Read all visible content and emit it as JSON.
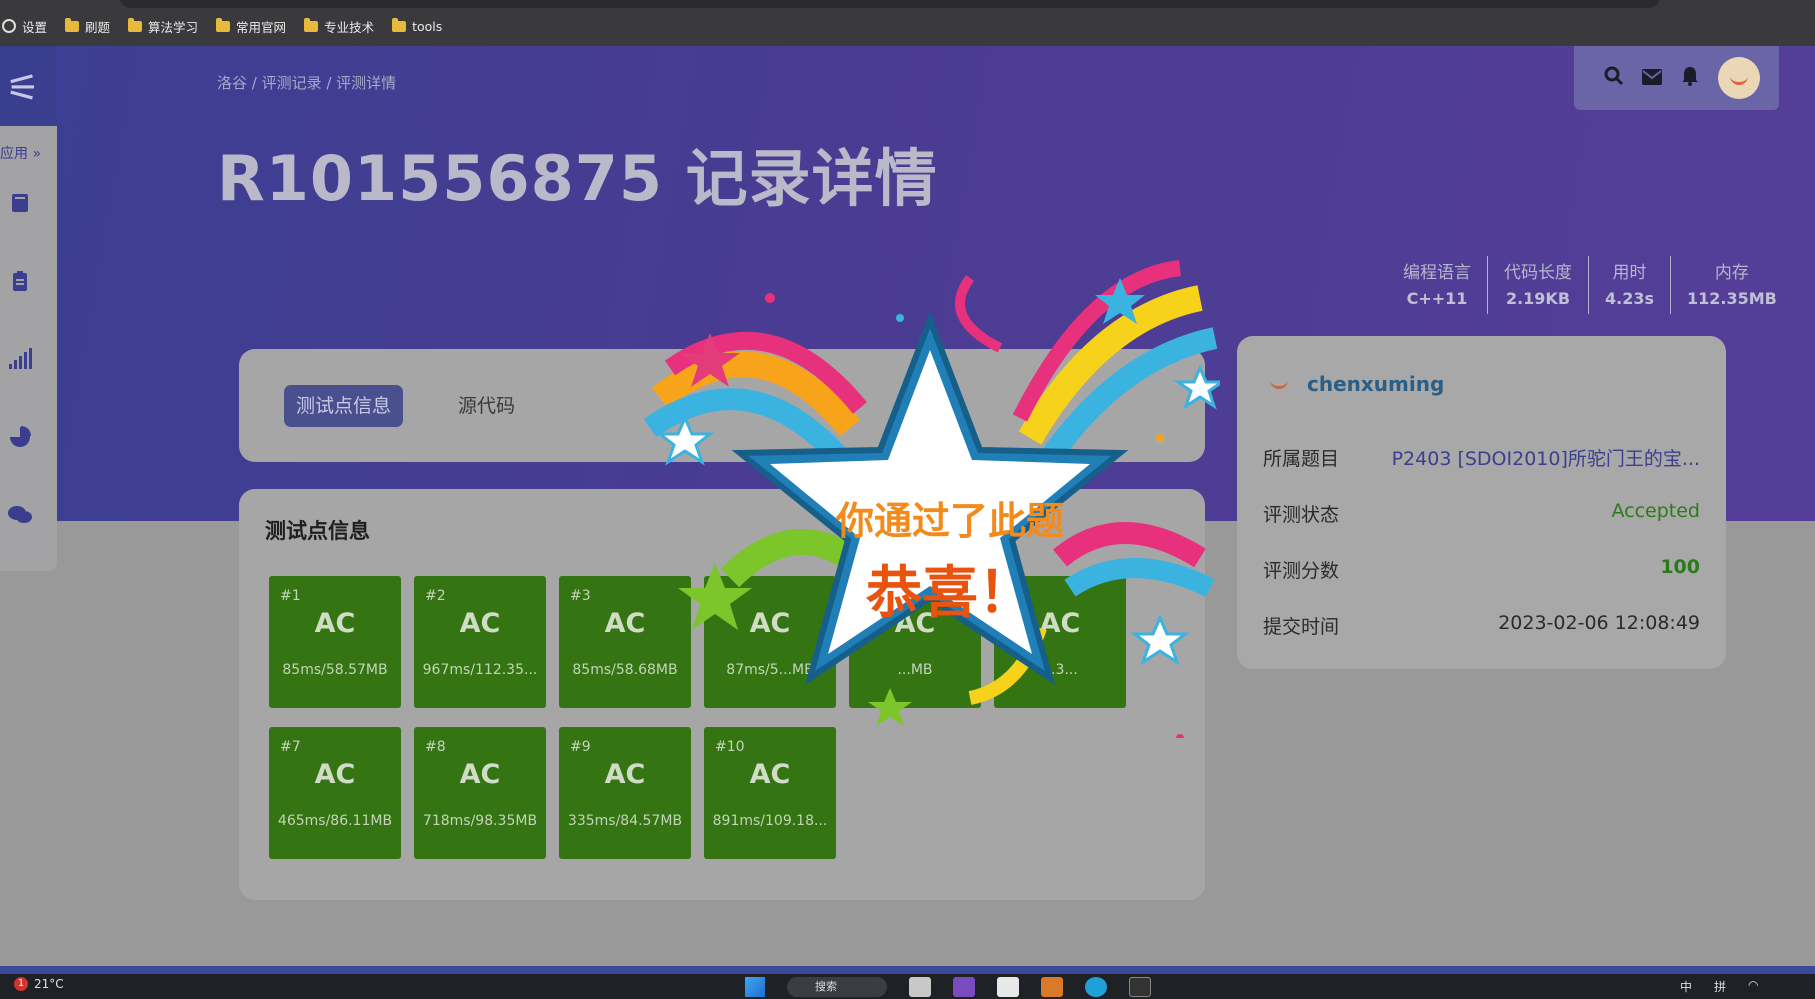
{
  "bookmarks": [
    "设置",
    "刷题",
    "算法学习",
    "常用官网",
    "专业技术",
    "tools"
  ],
  "sidebar": {
    "apps_label": "应用 »",
    "icons": [
      "book-icon",
      "clipboard-icon",
      "signal-bars-icon",
      "pie-chart-icon",
      "chat-icon"
    ]
  },
  "breadcrumb": "洛谷 / 评测记录 / 评测详情",
  "page_title": "R101556875 记录详情",
  "stats": [
    {
      "label": "编程语言",
      "value": "C++11"
    },
    {
      "label": "代码长度",
      "value": "2.19KB"
    },
    {
      "label": "用时",
      "value": "4.23s"
    },
    {
      "label": "内存",
      "value": "112.35MB"
    }
  ],
  "tabs": {
    "active": "测试点信息",
    "other": "源代码"
  },
  "tests": {
    "title": "测试点信息",
    "cases": [
      {
        "num": "#1",
        "status": "AC",
        "info": "85ms/58.57MB"
      },
      {
        "num": "#2",
        "status": "AC",
        "info": "967ms/112.35..."
      },
      {
        "num": "#3",
        "status": "AC",
        "info": "85ms/58.68MB"
      },
      {
        "num": "#4",
        "status": "AC",
        "info": "87ms/5...MB"
      },
      {
        "num": "#5",
        "status": "AC",
        "info": "...MB"
      },
      {
        "num": "#6",
        "status": "AC",
        "info": "...3..."
      },
      {
        "num": "#7",
        "status": "AC",
        "info": "465ms/86.11MB"
      },
      {
        "num": "#8",
        "status": "AC",
        "info": "718ms/98.35MB"
      },
      {
        "num": "#9",
        "status": "AC",
        "info": "335ms/84.57MB"
      },
      {
        "num": "#10",
        "status": "AC",
        "info": "891ms/109.18..."
      }
    ]
  },
  "info": {
    "username": "chenxuming",
    "rows": [
      {
        "label": "所属题目",
        "value": "P2403 [SDOI2010]所驼门王的宝..."
      },
      {
        "label": "评测状态",
        "value": "Accepted"
      },
      {
        "label": "评测分数",
        "value": "100"
      },
      {
        "label": "提交时间",
        "value": "2023-02-06 12:08:49"
      }
    ]
  },
  "celebration": {
    "line1": "你通过了此题",
    "line2": "恭喜！"
  },
  "taskbar": {
    "notification_count": "1",
    "temperature": "21°C",
    "search": "搜索",
    "tray1": "中",
    "tray2": "拼"
  },
  "colors": {
    "accent": "#4a4f8e",
    "ac_green": "#357413",
    "accepted": "#2f7a18"
  }
}
